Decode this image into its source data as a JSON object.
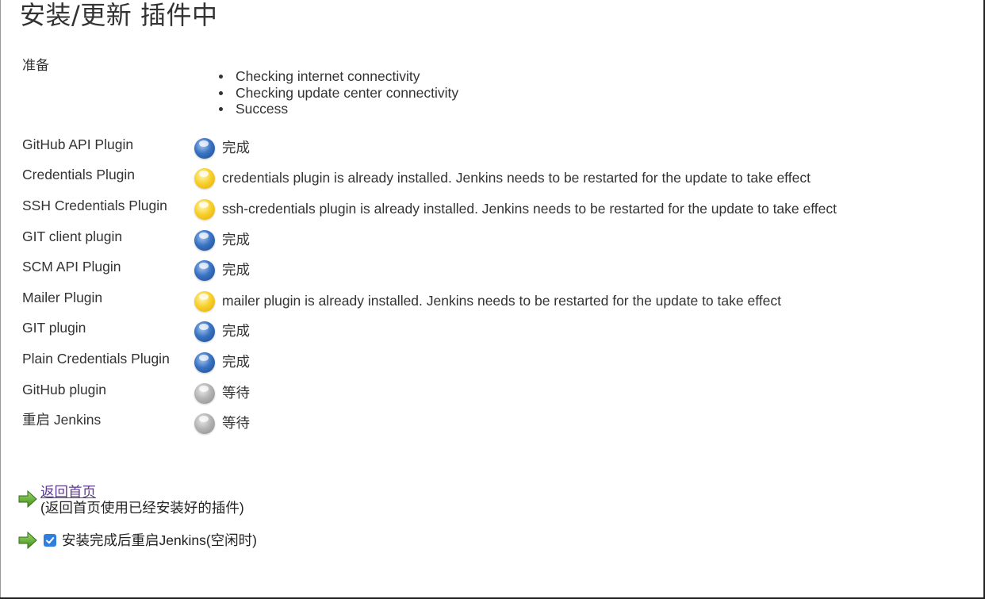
{
  "page": {
    "title": "安装/更新 插件中"
  },
  "preparation": {
    "label": "准备",
    "checks": [
      "Checking internet connectivity",
      "Checking update center connectivity",
      "Success"
    ]
  },
  "plugins": [
    {
      "name": "GitHub API Plugin",
      "status_color": "blue",
      "status": "完成"
    },
    {
      "name": "Credentials Plugin",
      "status_color": "yellow",
      "status": "credentials plugin is already installed. Jenkins needs to be restarted for the update to take effect"
    },
    {
      "name": "SSH Credentials Plugin",
      "status_color": "yellow",
      "status": "ssh-credentials plugin is already installed. Jenkins needs to be restarted for the update to take effect"
    },
    {
      "name": "GIT client plugin",
      "status_color": "blue",
      "status": "完成"
    },
    {
      "name": "SCM API Plugin",
      "status_color": "blue",
      "status": "完成"
    },
    {
      "name": "Mailer Plugin",
      "status_color": "yellow",
      "status": "mailer plugin is already installed. Jenkins needs to be restarted for the update to take effect"
    },
    {
      "name": "GIT plugin",
      "status_color": "blue",
      "status": "完成"
    },
    {
      "name": "Plain Credentials Plugin",
      "status_color": "blue",
      "status": "完成"
    },
    {
      "name": "GitHub plugin",
      "status_color": "grey",
      "status": "等待"
    },
    {
      "name": "重启 Jenkins",
      "status_color": "grey",
      "status": "等待"
    }
  ],
  "footer": {
    "back_link": "返回首页",
    "back_hint": "(返回首页使用已经安装好的插件)",
    "restart_label": "安装完成后重启Jenkins(空闲时)",
    "restart_checked": true
  },
  "colors": {
    "link": "#5b3a8c",
    "checkbox": "#2f7fe0",
    "arrow": "#5ba52d"
  }
}
